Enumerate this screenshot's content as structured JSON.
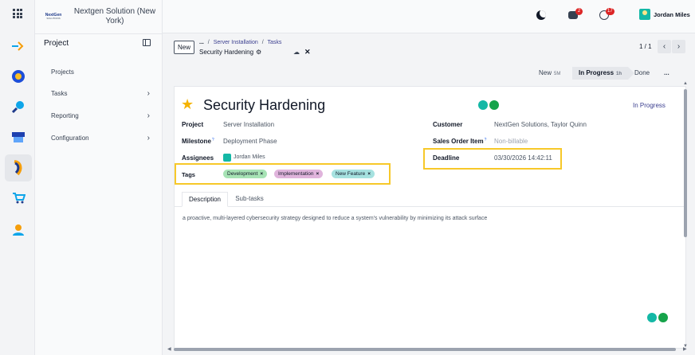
{
  "company": {
    "logo_text": "NextGen",
    "logo_sub": "SOLUTIONS",
    "name": "Nextgen Solution (New York)"
  },
  "sidebar": {
    "title": "Project",
    "items": [
      {
        "label": "Projects",
        "has_chevron": false
      },
      {
        "label": "Tasks",
        "has_chevron": true
      },
      {
        "label": "Reporting",
        "has_chevron": true
      },
      {
        "label": "Configuration",
        "has_chevron": true
      }
    ]
  },
  "topbar": {
    "messages_count": "2",
    "activities_count": "17",
    "user_name": "Jordan Miles"
  },
  "breadcrumb": {
    "new_label": "New",
    "more": "...",
    "sep": "/",
    "items": [
      "Server Installation",
      "Tasks"
    ],
    "current": "Security Hardening"
  },
  "pager": {
    "text": "1 / 1",
    "prev": "‹",
    "next": "›"
  },
  "status": {
    "stages": [
      {
        "label": "New",
        "meta": "5M"
      },
      {
        "label": "In Progress",
        "meta": "1h"
      },
      {
        "label": "Done",
        "meta": ""
      }
    ],
    "active": "In Progress",
    "more": "..."
  },
  "task": {
    "title": "Security Hardening",
    "stage_label": "In Progress",
    "fields": {
      "project_label": "Project",
      "project": "Server Installation",
      "milestone_label": "Milestone",
      "milestone": "Deployment Phase",
      "assignees_label": "Assignees",
      "assignee": "Jordan Miles",
      "tags_label": "Tags",
      "customer_label": "Customer",
      "customer": "NextGen Solutions, Taylor Quinn",
      "sales_order_label": "Sales Order Item",
      "sales_order": "Non-billable",
      "deadline_label": "Deadline",
      "deadline": "03/30/2026 14:42:11",
      "help_mark": "?"
    },
    "tags": [
      {
        "label": "Development",
        "color": "#a7e3b5"
      },
      {
        "label": "Implementation",
        "color": "#e0b4dc"
      },
      {
        "label": "New Feature",
        "color": "#a6e2e0"
      }
    ],
    "tab_labels": [
      "Description",
      "Sub-tasks"
    ],
    "description": "a proactive, multi-layered cybersecurity strategy designed to reduce a system's vulnerability by minimizing its attack surface"
  },
  "colors": {
    "accent": "#3b3f8f",
    "highlight": "#f7c829",
    "star": "#f5b300",
    "badge": "#dc2626"
  },
  "icons": {
    "apps": "apps-grid-icon",
    "theme": "moon-icon",
    "chat": "chat-icon",
    "activity": "clock-icon",
    "star": "star-icon",
    "gear": "gear-icon",
    "cloud": "cloud-upload-icon",
    "discard": "close-icon"
  }
}
